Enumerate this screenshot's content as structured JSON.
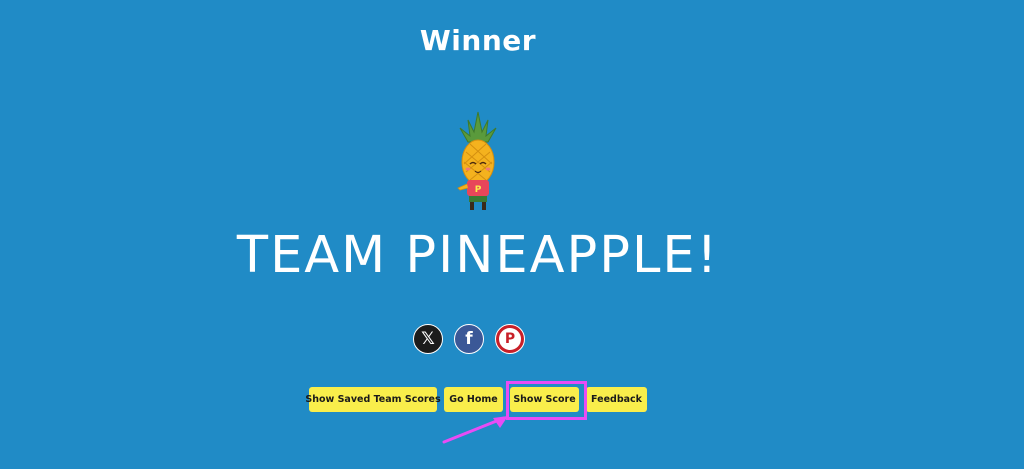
{
  "heading": "Winner",
  "team_name": "TEAM PINEAPPLE!",
  "mascot": {
    "icon": "pineapple-mascot",
    "shirt_letter": "P"
  },
  "social": {
    "x_label": "𝕏",
    "facebook_label": "f",
    "pinterest_label": "P"
  },
  "actions": {
    "saved_scores": "Show Saved Team Scores",
    "go_home": "Go Home",
    "show_score": "Show Score",
    "feedback": "Feedback"
  },
  "colors": {
    "background": "#208bc6",
    "button": "#f9ee4b",
    "highlight": "#e84cf5"
  }
}
